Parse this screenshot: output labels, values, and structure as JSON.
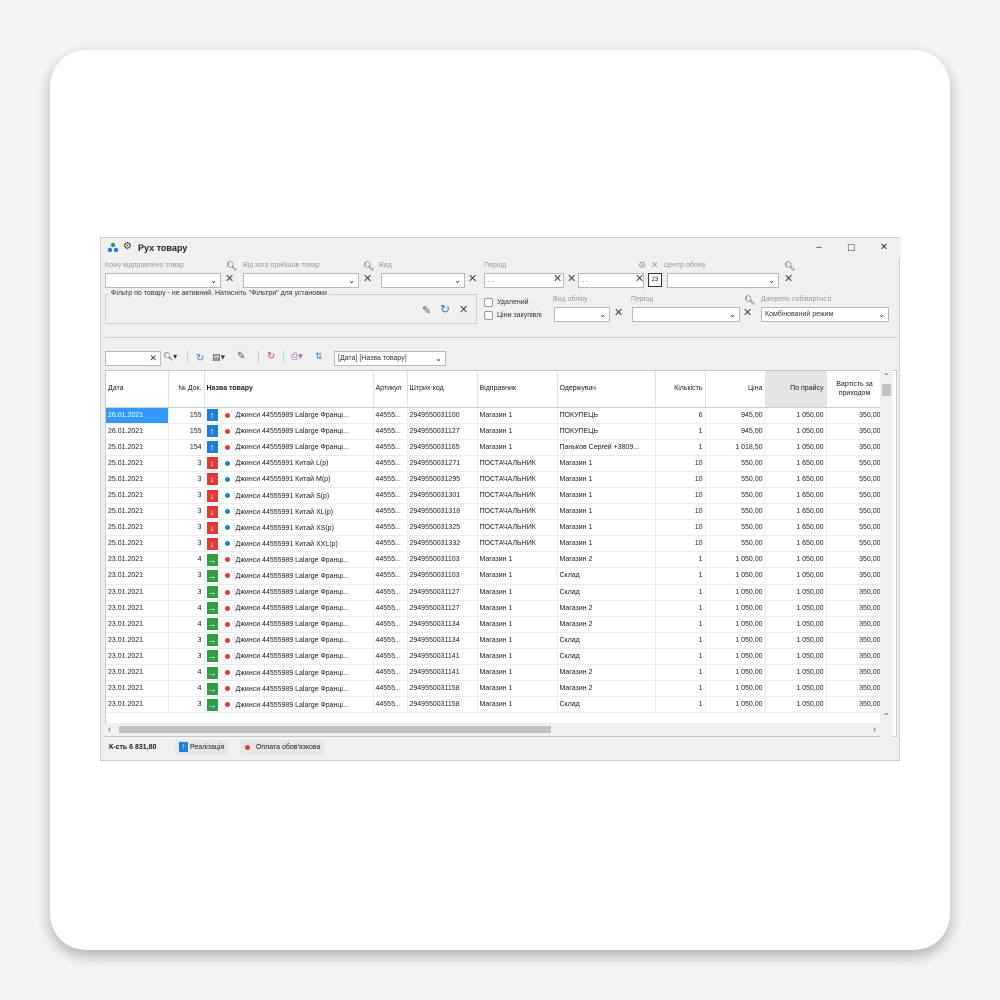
{
  "window": {
    "title": "Рух товару",
    "controls": {
      "minimize": "–",
      "maximize": "☐",
      "close": "✕"
    }
  },
  "filters": {
    "to_label": "Кому відправлено товар",
    "from_label": "Від кого прийшов товар",
    "type_label": "Вид",
    "period_label": "Період",
    "center_label": "Центр обліку",
    "date_from": " .  .",
    "date_to": " .  .",
    "calendar_label": "23",
    "filter_notice": "Фільтр по товару - не активний. Натисніть \"Фільтри\" для установки",
    "chk_deleted": "Удалений",
    "chk_prices": "Ціни закупівлі",
    "account_type_label": "Вид обліку",
    "period2_label": "Період",
    "cost_source_label": "Джерело собівартості",
    "cost_source_value": "Комбінований режим"
  },
  "toolbar": {
    "sort_value": "[Дата]  [Назва товару]"
  },
  "columns": [
    "Дата",
    "№ Док.",
    "Назва товару",
    "Артикул",
    "Штрих-код",
    "Відправник",
    "Одержувач",
    "Кількість",
    "Ціна",
    "По прайсу",
    "Вартість за приходом"
  ],
  "rows": [
    {
      "date": "26.01.2021",
      "doc": "155",
      "dir": "up",
      "dot": "red",
      "name": "Джинси 44555989 Lalarge Франці...",
      "art": "44555...",
      "bar": "2949550031100",
      "from": "Магазин 1",
      "to": "ПОКУПЕЦЬ",
      "qty": "6",
      "price": "945,00",
      "list": "1 050,00",
      "cost": "350,00",
      "sel": true
    },
    {
      "date": "26.01.2021",
      "doc": "155",
      "dir": "up",
      "dot": "red",
      "name": "Джинси 44555989 Lalarge Франці...",
      "art": "44555...",
      "bar": "2949550031127",
      "from": "Магазин 1",
      "to": "ПОКУПЕЦЬ",
      "qty": "1",
      "price": "945,00",
      "list": "1 050,00",
      "cost": "350,00"
    },
    {
      "date": "25.01.2021",
      "doc": "154",
      "dir": "up",
      "dot": "red",
      "name": "Джинси 44555989 Lalarge Франці...",
      "art": "44555...",
      "bar": "2949550031165",
      "from": "Магазин 1",
      "to": "Паньков Сергей +3809...",
      "qty": "1",
      "price": "1 018,50",
      "list": "1 050,00",
      "cost": "350,00"
    },
    {
      "date": "25.01.2021",
      "doc": "3",
      "dir": "down",
      "dot": "blue",
      "name": "Джинси 44555991 Китай L(р)",
      "art": "44555...",
      "bar": "2949550031271",
      "from": "ПОСТАЧАЛЬНИК",
      "to": "Магазин 1",
      "qty": "10",
      "price": "550,00",
      "list": "1 650,00",
      "cost": "550,00"
    },
    {
      "date": "25.01.2021",
      "doc": "3",
      "dir": "down",
      "dot": "blue",
      "name": "Джинси 44555991 Китай M(р)",
      "art": "44555...",
      "bar": "2949550031295",
      "from": "ПОСТАЧАЛЬНИК",
      "to": "Магазин 1",
      "qty": "10",
      "price": "550,00",
      "list": "1 650,00",
      "cost": "550,00"
    },
    {
      "date": "25.01.2021",
      "doc": "3",
      "dir": "down",
      "dot": "blue",
      "name": "Джинси 44555991 Китай S(р)",
      "art": "44555...",
      "bar": "2949550031301",
      "from": "ПОСТАЧАЛЬНИК",
      "to": "Магазин 1",
      "qty": "10",
      "price": "550,00",
      "list": "1 650,00",
      "cost": "550,00"
    },
    {
      "date": "25.01.2021",
      "doc": "3",
      "dir": "down",
      "dot": "blue",
      "name": "Джинси 44555991 Китай XL(р)",
      "art": "44555...",
      "bar": "2949550031318",
      "from": "ПОСТАЧАЛЬНИК",
      "to": "Магазин 1",
      "qty": "10",
      "price": "550,00",
      "list": "1 650,00",
      "cost": "550,00"
    },
    {
      "date": "25.01.2021",
      "doc": "3",
      "dir": "down",
      "dot": "blue",
      "name": "Джинси 44555991 Китай XS(р)",
      "art": "44555...",
      "bar": "2949550031325",
      "from": "ПОСТАЧАЛЬНИК",
      "to": "Магазин 1",
      "qty": "10",
      "price": "550,00",
      "list": "1 650,00",
      "cost": "550,00"
    },
    {
      "date": "25.01.2021",
      "doc": "3",
      "dir": "down",
      "dot": "blue",
      "name": "Джинси 44555991 Китай XXL(р)",
      "art": "44555...",
      "bar": "2949550031332",
      "from": "ПОСТАЧАЛЬНИК",
      "to": "Магазин 1",
      "qty": "10",
      "price": "550,00",
      "list": "1 650,00",
      "cost": "550,00"
    },
    {
      "date": "23.01.2021",
      "doc": "4",
      "dir": "right",
      "dot": "red",
      "name": "Джинси 44555989 Lalarge Франці...",
      "art": "44555...",
      "bar": "2949550031103",
      "from": "Магазин 1",
      "to": "Магазин 2",
      "qty": "1",
      "price": "1 050,00",
      "list": "1 050,00",
      "cost": "350,00"
    },
    {
      "date": "23.01.2021",
      "doc": "3",
      "dir": "right",
      "dot": "red",
      "name": "Джинси 44555989 Lalarge Франці...",
      "art": "44555...",
      "bar": "2949550031103",
      "from": "Магазин 1",
      "to": "Склад",
      "qty": "1",
      "price": "1 050,00",
      "list": "1 050,00",
      "cost": "350,00"
    },
    {
      "date": "23.01.2021",
      "doc": "3",
      "dir": "right",
      "dot": "red",
      "name": "Джинси 44555989 Lalarge Франці...",
      "art": "44555...",
      "bar": "2949550031127",
      "from": "Магазин 1",
      "to": "Склад",
      "qty": "1",
      "price": "1 050,00",
      "list": "1 050,00",
      "cost": "350,00"
    },
    {
      "date": "23.01.2021",
      "doc": "4",
      "dir": "right",
      "dot": "red",
      "name": "Джинси 44555989 Lalarge Франці...",
      "art": "44555...",
      "bar": "2949550031127",
      "from": "Магазин 1",
      "to": "Магазин 2",
      "qty": "1",
      "price": "1 050,00",
      "list": "1 050,00",
      "cost": "350,00"
    },
    {
      "date": "23.01.2021",
      "doc": "4",
      "dir": "right",
      "dot": "red",
      "name": "Джинси 44555989 Lalarge Франці...",
      "art": "44555...",
      "bar": "2949550031134",
      "from": "Магазин 1",
      "to": "Магазин 2",
      "qty": "1",
      "price": "1 050,00",
      "list": "1 050,00",
      "cost": "350,00"
    },
    {
      "date": "23.01.2021",
      "doc": "3",
      "dir": "right",
      "dot": "red",
      "name": "Джинси 44555989 Lalarge Франці...",
      "art": "44555...",
      "bar": "2949550031134",
      "from": "Магазин 1",
      "to": "Склад",
      "qty": "1",
      "price": "1 050,00",
      "list": "1 050,00",
      "cost": "350,00"
    },
    {
      "date": "23.01.2021",
      "doc": "3",
      "dir": "right",
      "dot": "red",
      "name": "Джинси 44555989 Lalarge Франці...",
      "art": "44555...",
      "bar": "2949550031141",
      "from": "Магазин 1",
      "to": "Склад",
      "qty": "1",
      "price": "1 050,00",
      "list": "1 050,00",
      "cost": "350,00"
    },
    {
      "date": "23.01.2021",
      "doc": "4",
      "dir": "right",
      "dot": "red",
      "name": "Джинси 44555989 Lalarge Франці...",
      "art": "44555...",
      "bar": "2949550031141",
      "from": "Магазин 1",
      "to": "Магазин 2",
      "qty": "1",
      "price": "1 050,00",
      "list": "1 050,00",
      "cost": "350,00"
    },
    {
      "date": "23.01.2021",
      "doc": "4",
      "dir": "right",
      "dot": "red",
      "name": "Джинси 44555989 Lalarge Франці...",
      "art": "44555...",
      "bar": "2949550031158",
      "from": "Магазин 1",
      "to": "Магазин 2",
      "qty": "1",
      "price": "1 050,00",
      "list": "1 050,00",
      "cost": "350,00"
    },
    {
      "date": "23.01.2021",
      "doc": "3",
      "dir": "right",
      "dot": "red",
      "name": "Джинси 44555989 Lalarge Франці...",
      "art": "44555...",
      "bar": "2949550031158",
      "from": "Магазин 1",
      "to": "Склад",
      "qty": "1",
      "price": "1 050,00",
      "list": "1 050,00",
      "cost": "350,00"
    }
  ],
  "colors": {
    "arrow_up": "#1e7fd6",
    "arrow_down": "#e53935",
    "arrow_right": "#2ea043",
    "dot_red": "#e53935",
    "dot_blue": "#1e7fd6",
    "selection": "#3399ff"
  },
  "status": {
    "count": "К-сть 6 831,80",
    "realization": "Реалізація",
    "payment": "Оплата обов'язкова"
  }
}
